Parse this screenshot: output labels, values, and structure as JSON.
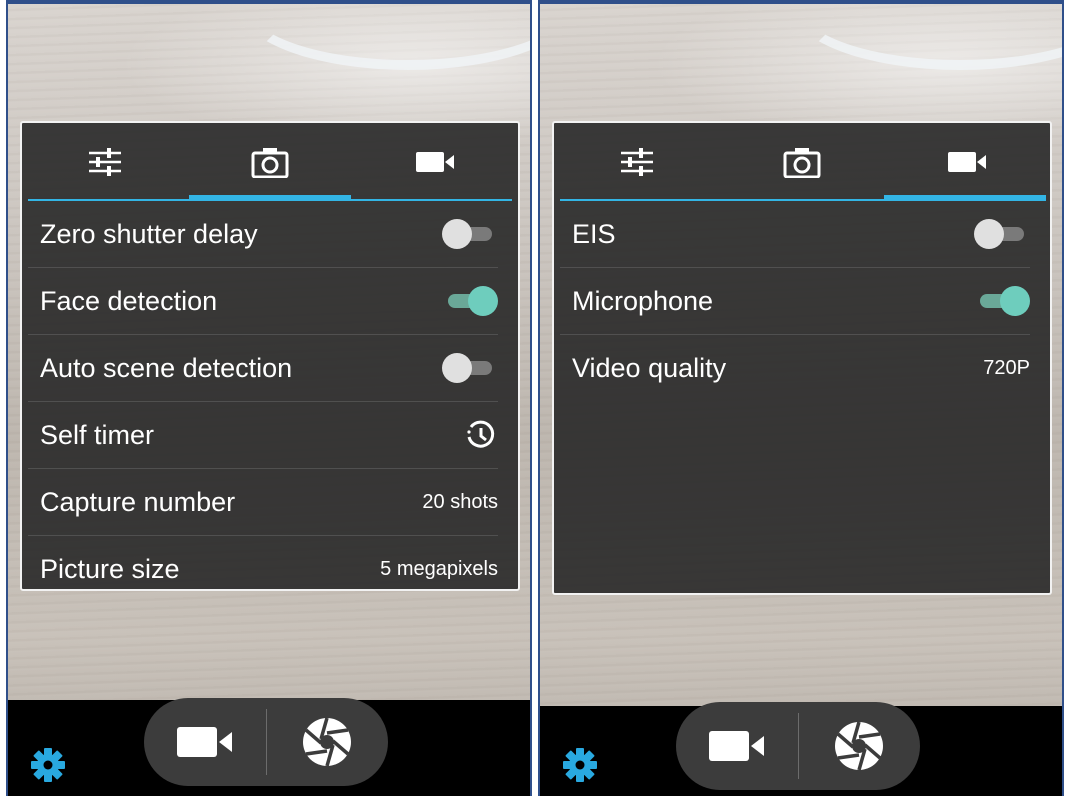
{
  "colors": {
    "accent": "#33b5e5",
    "switch_on": "#6ecdbd",
    "panel_bg": "#2a2a2a",
    "gear": "#29a9e0"
  },
  "left": {
    "tabs": [
      {
        "icon": "sliders-icon",
        "active": false
      },
      {
        "icon": "camera-icon",
        "active": true
      },
      {
        "icon": "video-camera-icon",
        "active": false
      }
    ],
    "settings": [
      {
        "label": "Zero shutter delay",
        "type": "toggle",
        "on": false
      },
      {
        "label": "Face detection",
        "type": "toggle",
        "on": true
      },
      {
        "label": "Auto scene detection",
        "type": "toggle",
        "on": false
      },
      {
        "label": "Self timer",
        "type": "icon",
        "icon": "timer-icon"
      },
      {
        "label": "Capture number",
        "type": "value",
        "value": "20 shots"
      },
      {
        "label": "Picture size",
        "type": "value",
        "value": "5 megapixels"
      }
    ]
  },
  "right": {
    "tabs": [
      {
        "icon": "sliders-icon",
        "active": false
      },
      {
        "icon": "camera-icon",
        "active": false
      },
      {
        "icon": "video-camera-icon",
        "active": true
      }
    ],
    "settings": [
      {
        "label": "EIS",
        "type": "toggle",
        "on": false
      },
      {
        "label": "Microphone",
        "type": "toggle",
        "on": true
      },
      {
        "label": "Video quality",
        "type": "value",
        "value": "720P"
      }
    ]
  },
  "bottom_controls": {
    "mode_button": "video-camera-icon",
    "shutter_button": "shutter-icon",
    "settings_button": "gear-icon"
  }
}
